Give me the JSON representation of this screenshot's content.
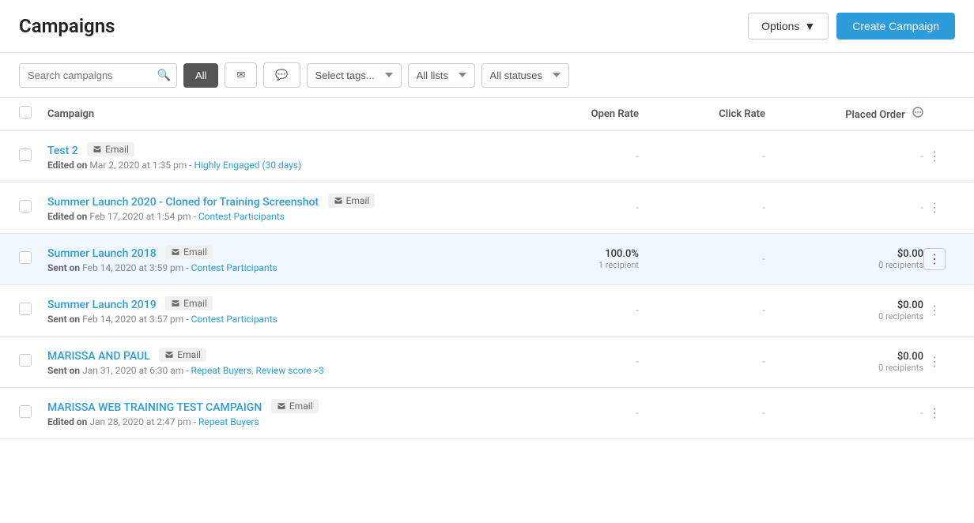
{
  "header": {
    "title": "Campaigns",
    "options_label": "Options",
    "create_label": "Create Campaign"
  },
  "toolbar": {
    "search_placeholder": "Search campaigns",
    "filter_all_label": "All",
    "tags_placeholder": "Select tags...",
    "lists_placeholder": "All lists",
    "statuses_placeholder": "All statuses"
  },
  "table": {
    "col_campaign": "Campaign",
    "col_open_rate": "Open Rate",
    "col_click_rate": "Click Rate",
    "col_placed_order": "Placed Order"
  },
  "campaigns": [
    {
      "id": 1,
      "name": "Test 2",
      "badge": "Email",
      "meta_action": "Edited on",
      "meta_date": "Mar 2, 2020 at 1:35 pm",
      "meta_tag": "Highly Engaged (30 days)",
      "open_rate": "-",
      "click_rate": "-",
      "placed_order": "-",
      "placed_order_sub": "",
      "highlighted": false
    },
    {
      "id": 2,
      "name": "Summer Launch 2020 - Cloned for Training Screenshot",
      "badge": "Email",
      "meta_action": "Edited on",
      "meta_date": "Feb 17, 2020 at 1:54 pm",
      "meta_tag": "Contest Participants",
      "open_rate": "-",
      "click_rate": "-",
      "placed_order": "-",
      "placed_order_sub": "",
      "highlighted": false
    },
    {
      "id": 3,
      "name": "Summer Launch 2018",
      "badge": "Email",
      "meta_action": "Sent on",
      "meta_date": "Feb 14, 2020 at 3:59 pm",
      "meta_tag": "Contest Participants",
      "open_rate": "100.0%",
      "open_rate_sub": "1 recipient",
      "click_rate": "-",
      "placed_order": "$0.00",
      "placed_order_sub": "0 recipients",
      "highlighted": true
    },
    {
      "id": 4,
      "name": "Summer Launch 2019",
      "badge": "Email",
      "meta_action": "Sent on",
      "meta_date": "Feb 14, 2020 at 3:57 pm",
      "meta_tag": "Contest Participants",
      "open_rate": "-",
      "click_rate": "-",
      "placed_order": "$0.00",
      "placed_order_sub": "0 recipients",
      "highlighted": false
    },
    {
      "id": 5,
      "name": "MARISSA AND PAUL",
      "badge": "Email",
      "meta_action": "Sent on",
      "meta_date": "Jan 31, 2020 at 6:30 am",
      "meta_tag": "Repeat Buyers, Review score >3",
      "open_rate": "-",
      "click_rate": "-",
      "placed_order": "$0.00",
      "placed_order_sub": "0 recipients",
      "highlighted": false
    },
    {
      "id": 6,
      "name": "MARISSA WEB TRAINING TEST CAMPAIGN",
      "badge": "Email",
      "meta_action": "Edited on",
      "meta_date": "Jan 28, 2020 at 2:47 pm",
      "meta_tag": "Repeat Buyers",
      "open_rate": "-",
      "click_rate": "-",
      "placed_order": "-",
      "placed_order_sub": "",
      "highlighted": false
    }
  ]
}
